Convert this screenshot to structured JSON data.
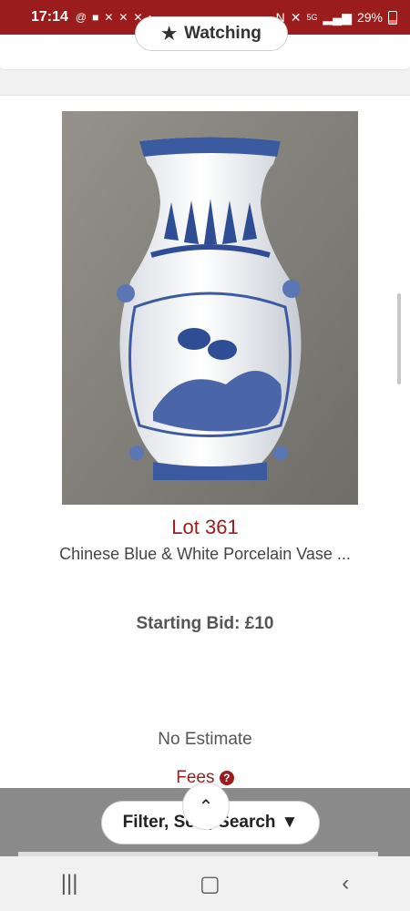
{
  "status_bar": {
    "time": "17:14",
    "battery": "29%",
    "network": "5G"
  },
  "watch": {
    "label": "Watching"
  },
  "lot": {
    "title": "Lot 361",
    "description": "Chinese Blue & White Porcelain Vase ...",
    "starting_bid": "Starting Bid: £10",
    "estimate": "No Estimate",
    "fees_label": "Fees"
  },
  "filter": {
    "label": "Filter, Sort, Search"
  },
  "colors": {
    "brand": "#9b1c1c",
    "statusbar": "#9b1c1c"
  }
}
